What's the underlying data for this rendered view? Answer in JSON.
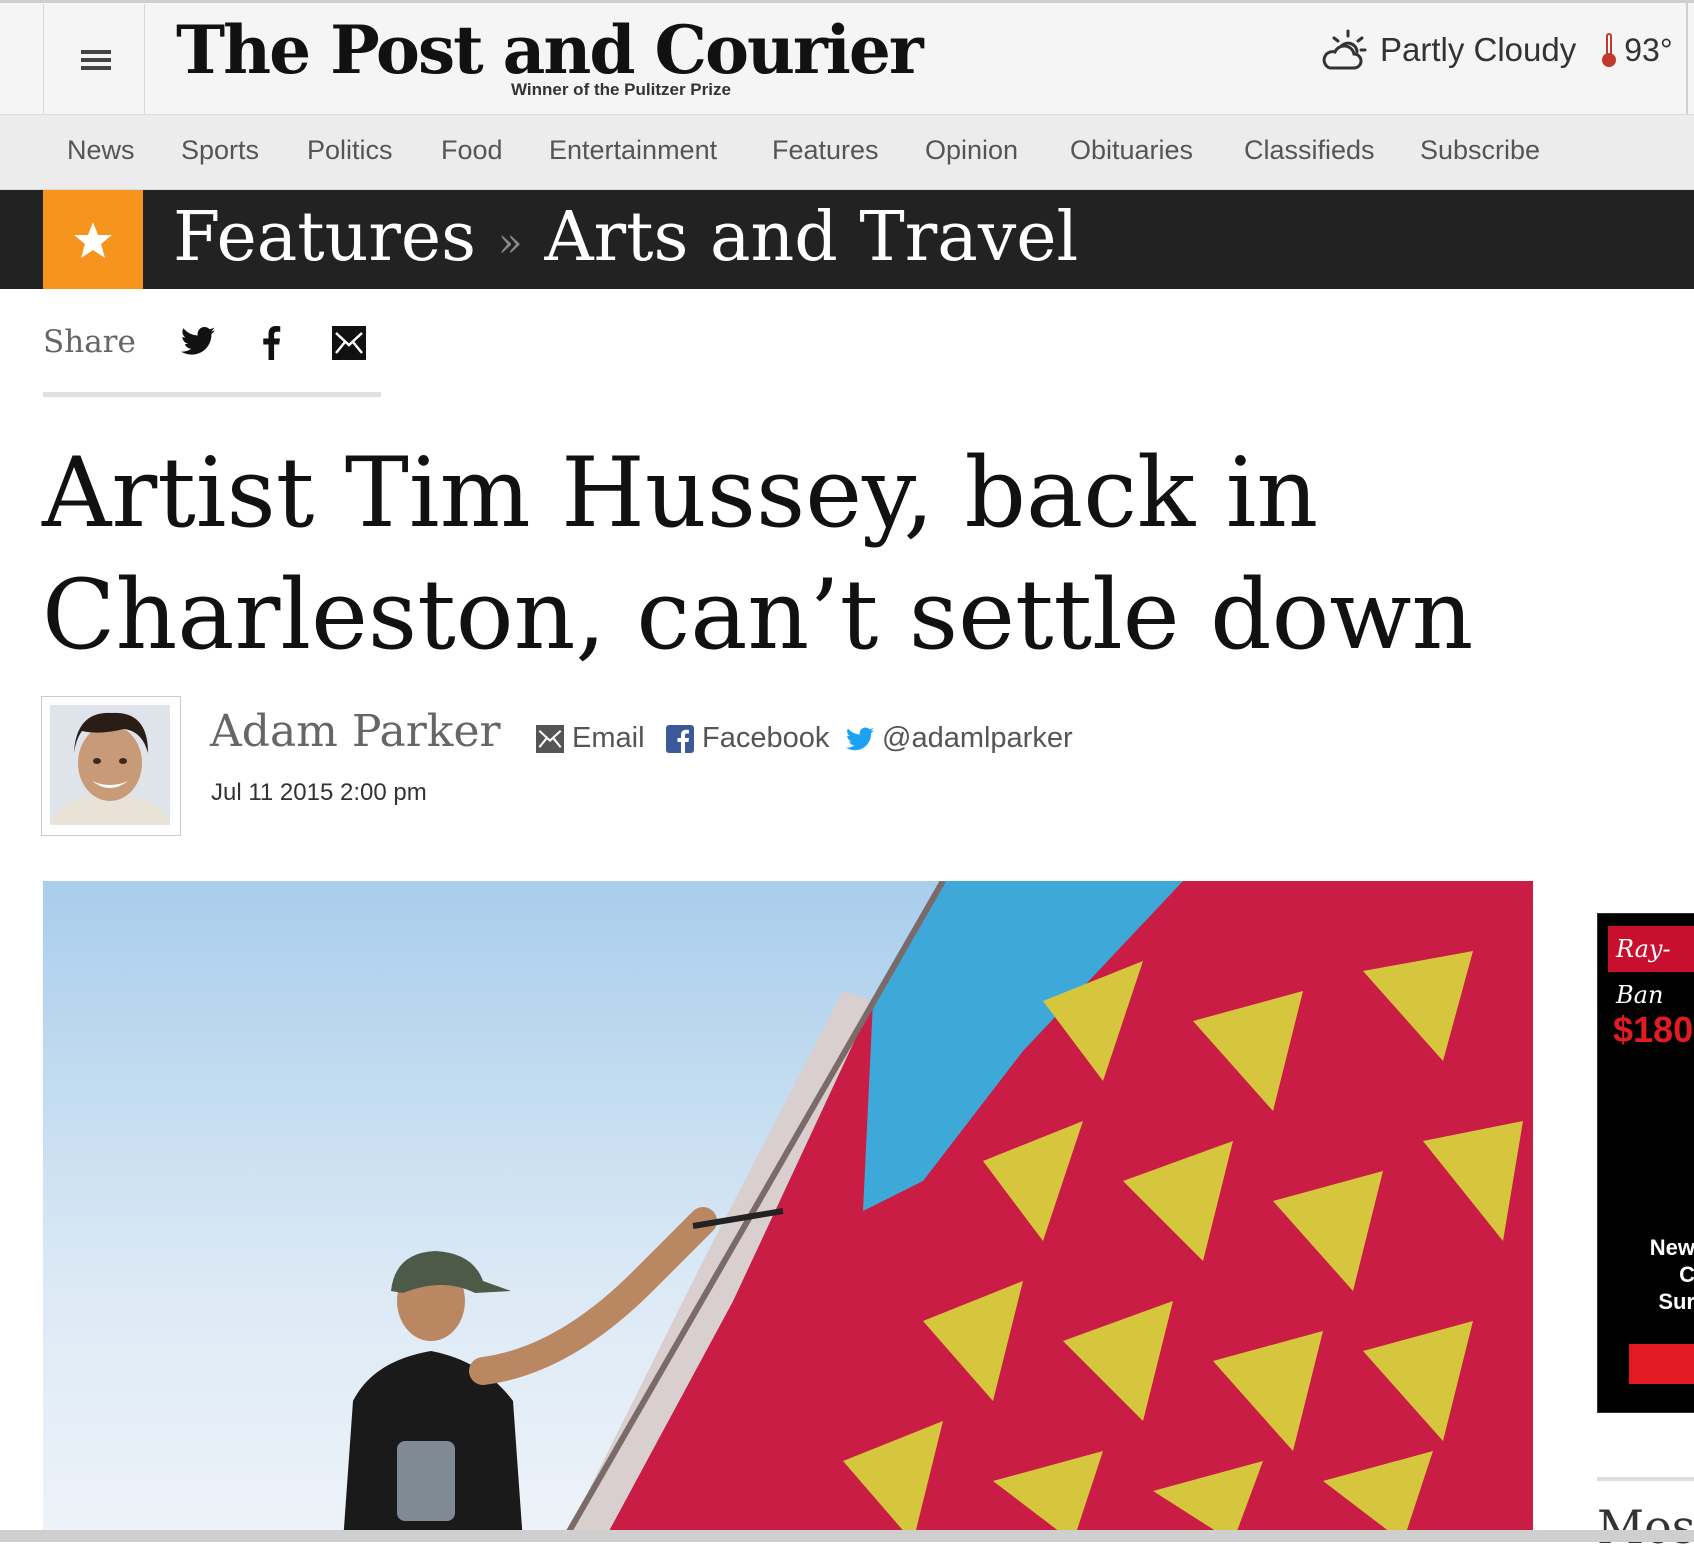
{
  "header": {
    "logo": "The Post and Courier",
    "tagline": "Winner of the Pulitzer Prize",
    "weather": {
      "condition": "Partly Cloudy",
      "temperature": "93°",
      "icon": "partly-cloudy-icon"
    }
  },
  "nav": {
    "items": [
      "News",
      "Sports",
      "Politics",
      "Food",
      "Entertainment",
      "Features",
      "Opinion",
      "Obituaries",
      "Classifieds",
      "Subscribe"
    ]
  },
  "section": {
    "icon": "star-icon",
    "crumbs": [
      "Features",
      "Arts and Travel"
    ],
    "separator": "»"
  },
  "share": {
    "label": "Share",
    "icons": [
      "twitter-icon",
      "facebook-icon",
      "email-icon"
    ]
  },
  "article": {
    "headline": "Artist Tim Hussey, back in Charleston, can’t settle down",
    "author": "Adam Parker",
    "contact": {
      "email": "Email",
      "facebook": "Facebook",
      "twitter": "@adamlparker"
    },
    "date": "Jul 11 2015 2:00 pm"
  },
  "sidebar": {
    "ad": {
      "brand": "Ray-Ban",
      "price": "$180",
      "copy_lines": [
        "New",
        "C",
        "Sur"
      ]
    },
    "most_heading": "Mos"
  },
  "colors": {
    "accent": "#f7941d",
    "section_bar": "#222222",
    "ad_red": "#e21b22"
  }
}
